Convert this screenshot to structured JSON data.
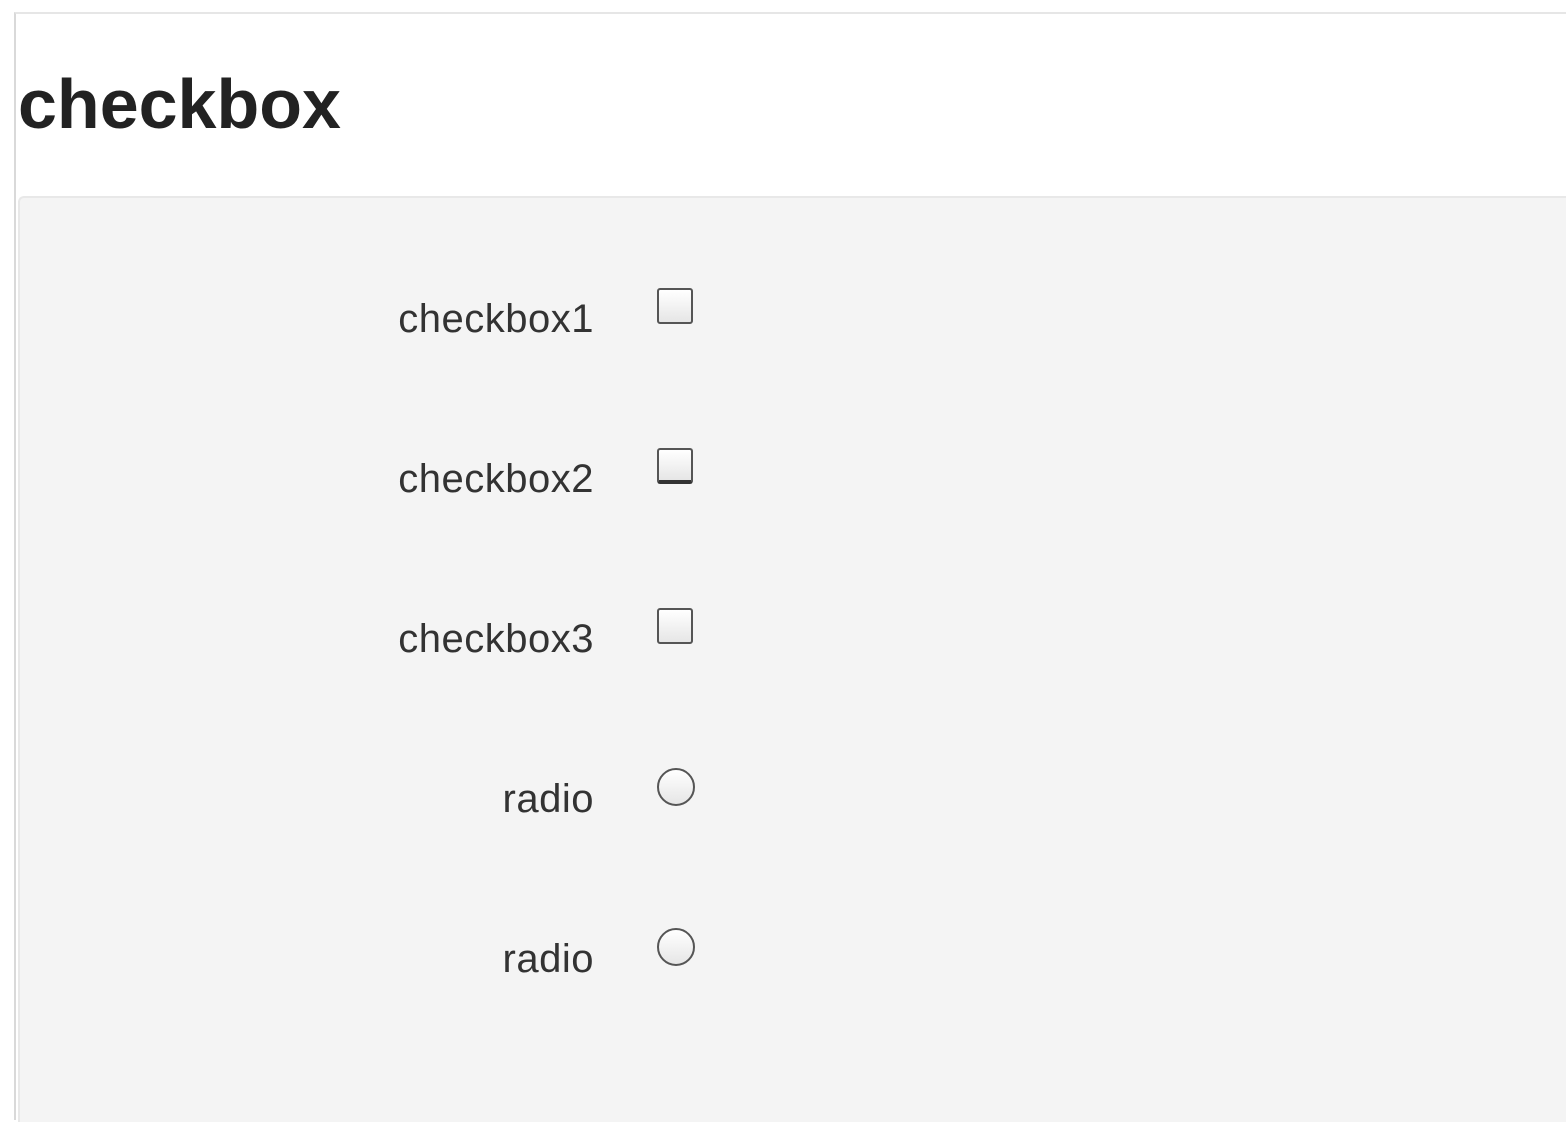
{
  "page": {
    "title": "checkbox"
  },
  "form": {
    "rows": [
      {
        "label": "checkbox1",
        "control": "checkbox",
        "checked": false
      },
      {
        "label": "checkbox2",
        "control": "checkbox",
        "checked": false
      },
      {
        "label": "checkbox3",
        "control": "checkbox",
        "checked": false
      },
      {
        "label": "radio",
        "control": "radio",
        "checked": false
      },
      {
        "label": "radio",
        "control": "radio",
        "checked": false
      }
    ]
  },
  "colors": {
    "panel_background": "#f4f4f4",
    "title_text": "#222222",
    "label_text": "#333333",
    "control_border": "#555555"
  }
}
